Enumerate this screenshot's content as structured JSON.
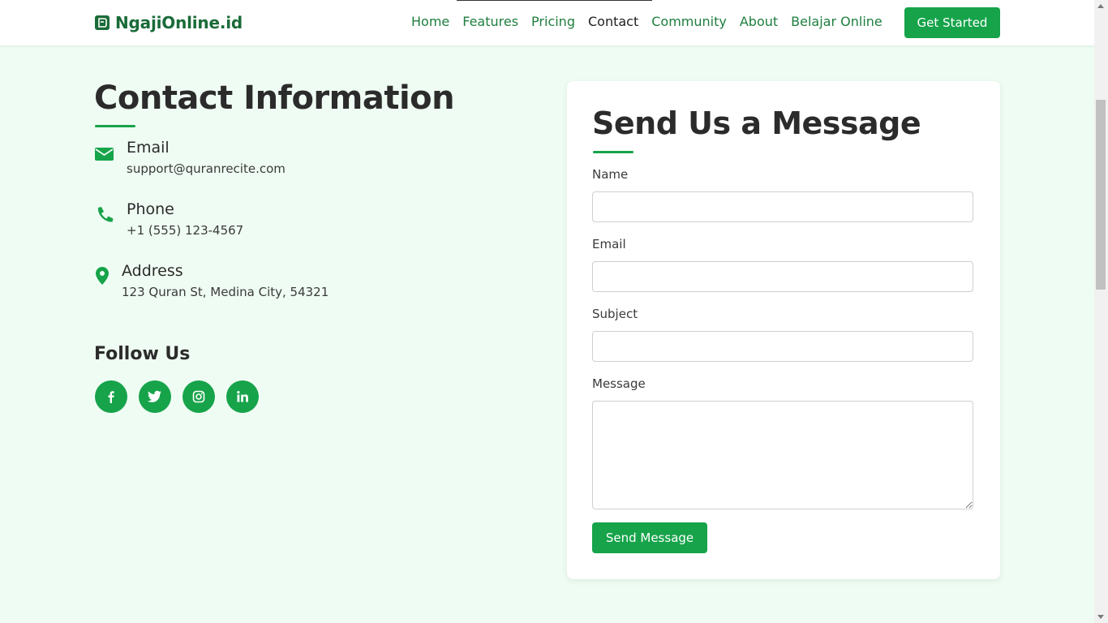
{
  "brand": {
    "name": "NgajiOnline.id",
    "accent": "#16a34a",
    "logo_icon": "quran-book-icon"
  },
  "nav": {
    "items": [
      {
        "label": "Home",
        "active": false
      },
      {
        "label": "Features",
        "active": false
      },
      {
        "label": "Pricing",
        "active": false
      },
      {
        "label": "Contact",
        "active": true
      },
      {
        "label": "Community",
        "active": false
      },
      {
        "label": "About",
        "active": false
      },
      {
        "label": "Belajar Online",
        "active": false
      }
    ],
    "cta_label": "Get Started"
  },
  "contact": {
    "title": "Contact Information",
    "email": {
      "icon": "envelope-icon",
      "label": "Email",
      "value": "support@quranrecite.com"
    },
    "phone": {
      "icon": "phone-icon",
      "label": "Phone",
      "value": "+1 (555) 123-4567"
    },
    "address": {
      "icon": "map-pin-icon",
      "label": "Address",
      "value": "123 Quran St, Medina City, 54321"
    },
    "follow_title": "Follow Us",
    "socials": [
      "facebook-icon",
      "twitter-icon",
      "instagram-icon",
      "linkedin-icon"
    ]
  },
  "form": {
    "title": "Send Us a Message",
    "name_label": "Name",
    "name_value": "",
    "email_label": "Email",
    "email_value": "",
    "subject_label": "Subject",
    "subject_value": "",
    "message_label": "Message",
    "message_value": "",
    "submit_label": "Send Message"
  }
}
